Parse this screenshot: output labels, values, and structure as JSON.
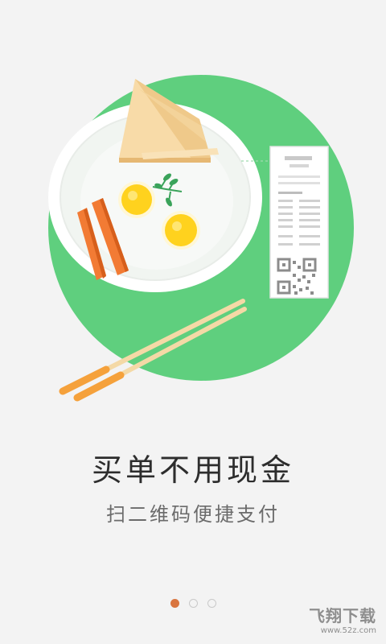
{
  "onboarding": {
    "title": "买单不用现金",
    "subtitle": "扫二维码便捷支付",
    "pagination": {
      "total": 3,
      "active_index": 0
    }
  },
  "watermark": {
    "main": "飞翔下载",
    "url": "www.52z.com"
  },
  "colors": {
    "accent_circle": "#5fcf7e",
    "active_dot": "#d9753f",
    "inactive_dot_border": "#c9c9c9"
  }
}
